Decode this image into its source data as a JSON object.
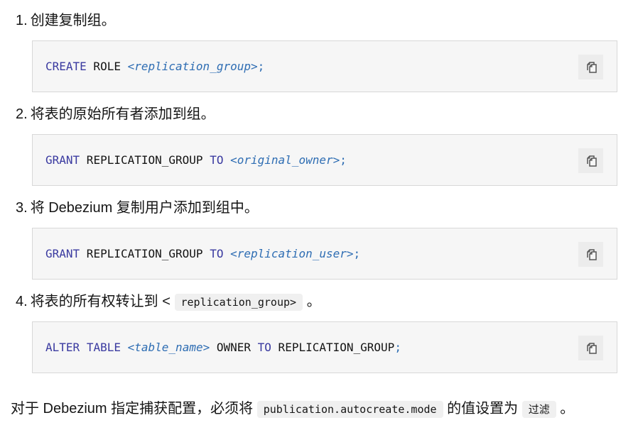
{
  "steps": [
    {
      "number": "1.",
      "title": "创建复制组。",
      "code": {
        "kw1": "CREATE",
        "plain1": " ROLE ",
        "placeholder": "<replication_group>",
        "end": ";"
      },
      "copy_icon": "copy-icon"
    },
    {
      "number": "2.",
      "title": "将表的原始所有者添加到组。",
      "code": {
        "kw1": "GRANT",
        "plain1": " REPLICATION_GROUP ",
        "kw2": "TO",
        "placeholder": "<original_owner>",
        "end": ";"
      },
      "copy_icon": "copy-icon"
    },
    {
      "number": "3.",
      "title": "将 Debezium 复制用户添加到组中。",
      "code": {
        "kw1": "GRANT",
        "plain1": " REPLICATION_GROUP ",
        "kw2": "TO",
        "placeholder": "<replication_user>",
        "end": ";"
      },
      "copy_icon": "copy-icon"
    },
    {
      "number": "4.",
      "title": "将表的所有权转让到 <",
      "inline_code": "replication_group>",
      "title_end": "。",
      "code": {
        "kw1": "ALTER",
        "kw1b": "TABLE",
        "placeholder": "<table_name>",
        "plain2": " OWNER ",
        "kw2": "TO",
        "plain3": " REPLICATION_GROUP",
        "end": ";"
      },
      "copy_icon": "copy-icon"
    }
  ],
  "footer_paragraph": {
    "text_before": "对于 Debezium 指定捕获配置，必须将 ",
    "inline_code_1": "publication.autocreate.mode",
    "text_middle": " 的值设置为 ",
    "inline_code_2": "过滤",
    "text_end": "。"
  }
}
